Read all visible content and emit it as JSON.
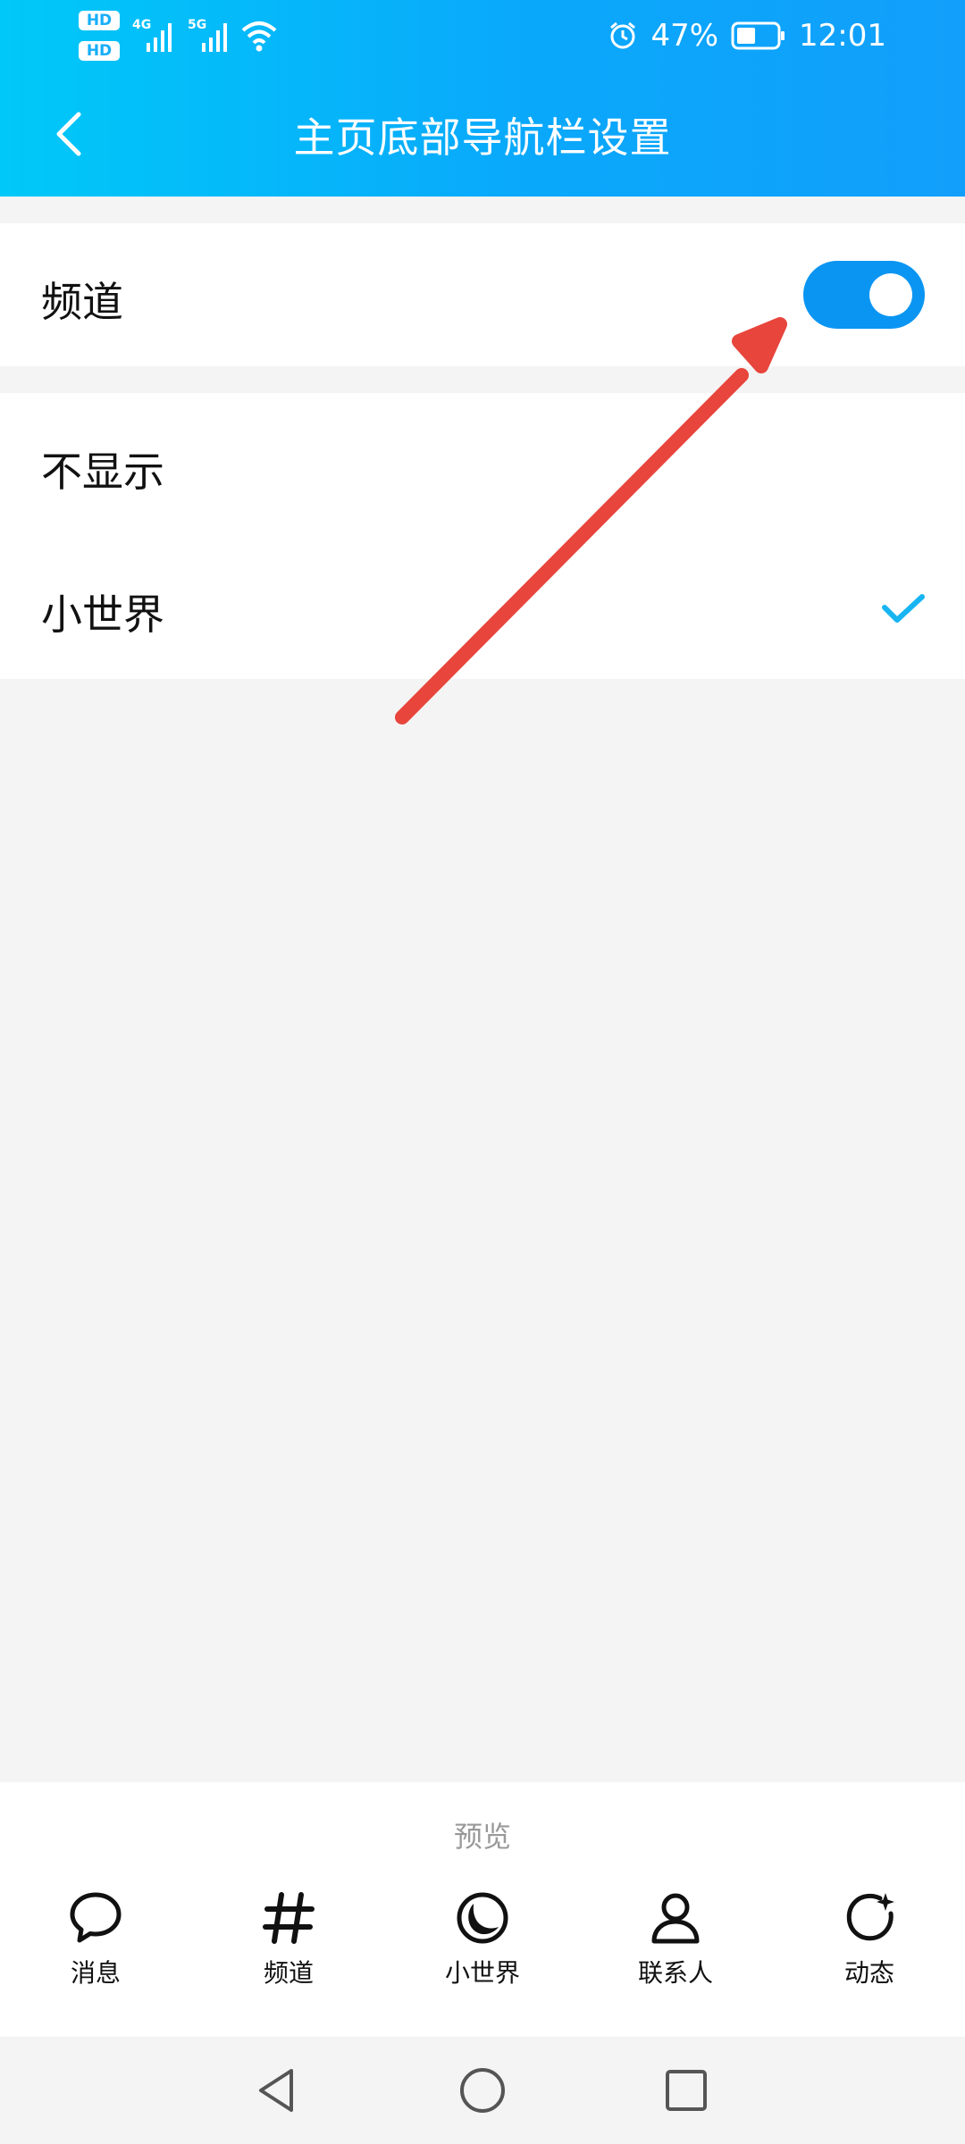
{
  "status_bar": {
    "hd1": "HD",
    "hd2": "HD",
    "sim1_net": "4G",
    "sim2_net": "5G",
    "battery": "47%",
    "time": "12:01"
  },
  "header": {
    "title": "主页底部导航栏设置",
    "back_icon": "chevron-left-icon",
    "bg_colors": [
      "#00c8f8",
      "#129ffb"
    ]
  },
  "settings": {
    "channel_row": {
      "label": "频道",
      "toggle_on": true
    },
    "options": [
      {
        "label": "不显示",
        "selected": false
      },
      {
        "label": "小世界",
        "selected": true
      }
    ]
  },
  "preview": {
    "label": "预览",
    "nav_items": [
      {
        "label": "消息",
        "icon": "message-bubble-icon"
      },
      {
        "label": "频道",
        "icon": "hashtag-icon"
      },
      {
        "label": "小世界",
        "icon": "small-world-icon"
      },
      {
        "label": "联系人",
        "icon": "contact-icon"
      },
      {
        "label": "动态",
        "icon": "refresh-star-icon"
      }
    ]
  },
  "system_nav": [
    "back-triangle-icon",
    "home-circle-icon",
    "recents-square-icon"
  ],
  "colors": {
    "accent": "#0a95f2",
    "check": "#17b5f2",
    "annotation_arrow": "#e8453c"
  }
}
